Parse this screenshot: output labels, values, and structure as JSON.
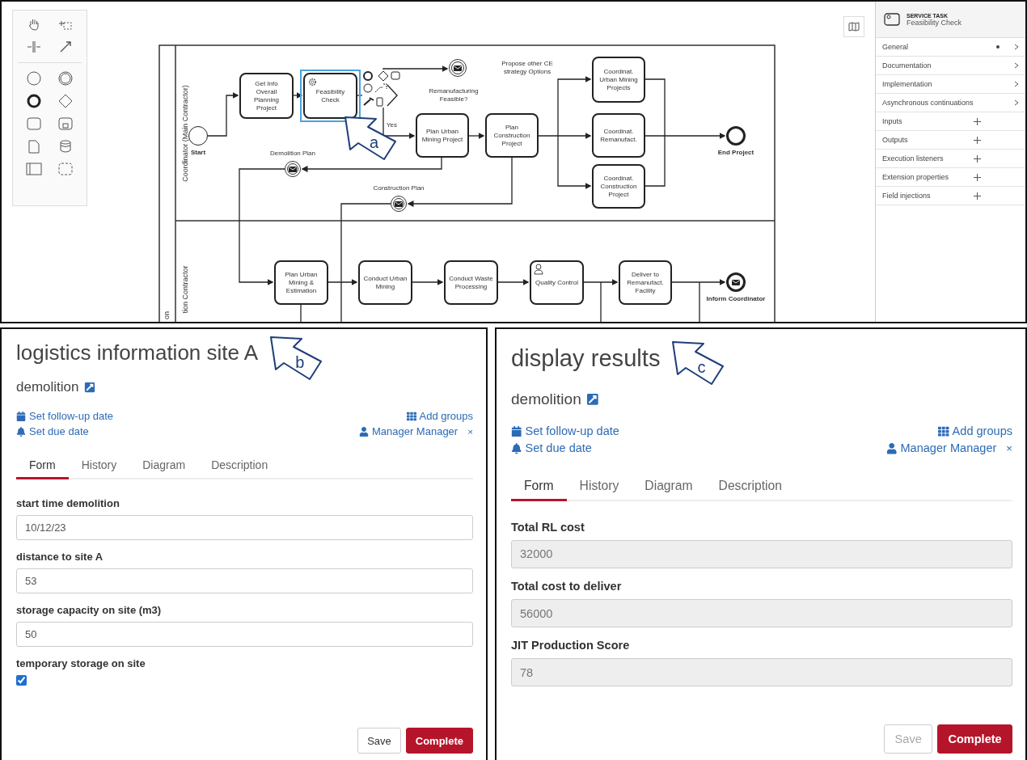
{
  "modeler": {
    "diagram": {
      "pool_label": "on",
      "lanes": [
        {
          "label": "Coordinator (Main Contractor)"
        },
        {
          "label": "tion Contractor"
        }
      ],
      "nodes": [
        {
          "kind": "task",
          "label": "Get Info Overall Planning Project",
          "selected": false
        },
        {
          "kind": "service_task",
          "label": "Feasibility Check",
          "selected": true
        },
        {
          "kind": "gateway",
          "label": "Remanufacturing Feasible?",
          "selected": false
        },
        {
          "kind": "message_event",
          "label": "Propose other CE strategy Options",
          "selected": false
        },
        {
          "kind": "task",
          "label": "Coordinat. Urban Mining Projects",
          "selected": false
        },
        {
          "kind": "start_event",
          "label": "Start",
          "selected": false
        },
        {
          "kind": "message_event",
          "label": "Demolition Plan",
          "selected": false
        },
        {
          "kind": "task",
          "label": "Plan Urban Mining Project",
          "selected": false
        },
        {
          "kind": "task",
          "label": "Plan Construction Project",
          "selected": false
        },
        {
          "kind": "task",
          "label": "Coordinat. Remanufact.",
          "selected": false
        },
        {
          "kind": "end_event",
          "label": "End Project",
          "selected": false
        },
        {
          "kind": "message_event",
          "label": "Construction Plan",
          "selected": false
        },
        {
          "kind": "task",
          "label": "Coordinat. Construction Project",
          "selected": false
        },
        {
          "kind": "task",
          "label": "Plan Urban Mining & Estimation",
          "selected": false
        },
        {
          "kind": "task",
          "label": "Conduct Urban Mining",
          "selected": false
        },
        {
          "kind": "task",
          "label": "Conduct Waste Processing",
          "selected": false
        },
        {
          "kind": "user_task",
          "label": "Quality Control",
          "selected": false
        },
        {
          "kind": "task",
          "label": "Deliver to Remanufact. Facility",
          "selected": false
        },
        {
          "kind": "message_end_event",
          "label": "Inform Coordinator",
          "selected": false
        }
      ],
      "flow_labels": [
        {
          "label": "Yes"
        }
      ],
      "callout": "a"
    },
    "properties": {
      "element_type": "SERVICE TASK",
      "element_name": "Feasibility Check",
      "groups": [
        {
          "kind": "section",
          "label": "General",
          "has_entries": true
        },
        {
          "kind": "section",
          "label": "Documentation",
          "has_entries": false
        },
        {
          "kind": "section",
          "label": "Implementation",
          "has_entries": false
        },
        {
          "kind": "section",
          "label": "Asynchronous continuations",
          "has_entries": false
        },
        {
          "kind": "list",
          "label": "Inputs"
        },
        {
          "kind": "list",
          "label": "Outputs"
        },
        {
          "kind": "list",
          "label": "Execution listeners"
        },
        {
          "kind": "list",
          "label": "Extension properties"
        },
        {
          "kind": "list",
          "label": "Field injections"
        }
      ]
    }
  },
  "task_forms": [
    {
      "title": "logistics information site A",
      "callout": "b",
      "process": "demolition",
      "actions": {
        "follow_up": "Set follow-up date",
        "due": "Set due date",
        "groups": "Add groups",
        "assignee": "Manager Manager",
        "remove": "×"
      },
      "tabs": [
        {
          "label": "Form",
          "selected": true
        },
        {
          "label": "History",
          "selected": false
        },
        {
          "label": "Diagram",
          "selected": false
        },
        {
          "label": "Description",
          "selected": false
        }
      ],
      "fields": [
        {
          "kind": "text",
          "label": "start time demolition",
          "value": "10/12/23",
          "disabled": false
        },
        {
          "kind": "text",
          "label": "distance to site A",
          "value": "53",
          "disabled": false
        },
        {
          "kind": "text",
          "label": "storage capacity on site (m3)",
          "value": "50",
          "disabled": false
        },
        {
          "kind": "checkbox",
          "label": "temporary storage on site",
          "checked": true
        }
      ],
      "buttons": [
        {
          "kind": "secondary",
          "label": "Save",
          "disabled": false
        },
        {
          "kind": "primary",
          "label": "Complete",
          "disabled": false
        }
      ]
    },
    {
      "title": "display results",
      "callout": "c",
      "process": "demolition",
      "actions": {
        "follow_up": "Set follow-up date",
        "due": "Set due date",
        "groups": "Add groups",
        "assignee": "Manager Manager",
        "remove": "×"
      },
      "tabs": [
        {
          "label": "Form",
          "selected": true
        },
        {
          "label": "History",
          "selected": false
        },
        {
          "label": "Diagram",
          "selected": false
        },
        {
          "label": "Description",
          "selected": false
        }
      ],
      "fields": [
        {
          "kind": "text",
          "label": "Total RL cost",
          "value": "32000",
          "disabled": true
        },
        {
          "kind": "text",
          "label": "Total cost to deliver",
          "value": "56000",
          "disabled": true
        },
        {
          "kind": "text",
          "label": "JIT Production Score",
          "value": "78",
          "disabled": true
        }
      ],
      "buttons": [
        {
          "kind": "secondary",
          "label": "Save",
          "disabled": true
        },
        {
          "kind": "primary",
          "label": "Complete",
          "disabled": false
        }
      ]
    }
  ]
}
